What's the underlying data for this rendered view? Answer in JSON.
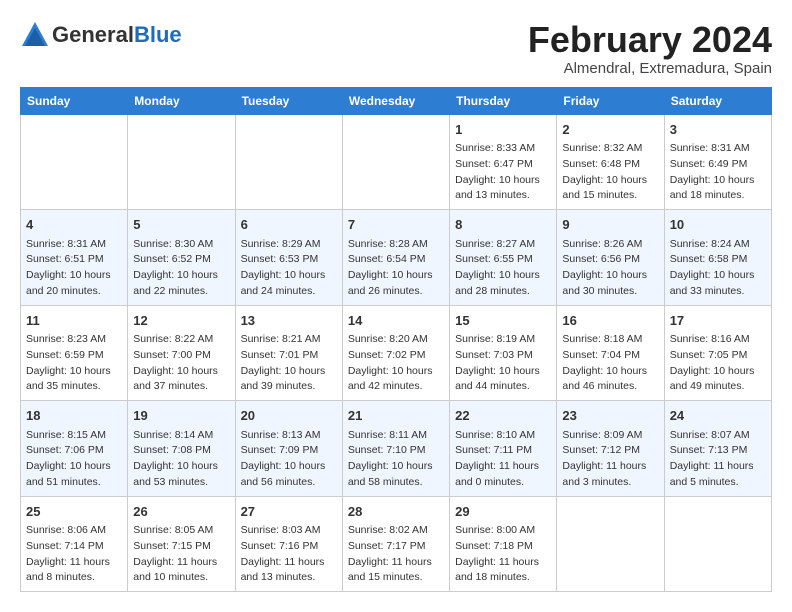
{
  "header": {
    "logo_general": "General",
    "logo_blue": "Blue",
    "month_year": "February 2024",
    "location": "Almendral, Extremadura, Spain"
  },
  "weekdays": [
    "Sunday",
    "Monday",
    "Tuesday",
    "Wednesday",
    "Thursday",
    "Friday",
    "Saturday"
  ],
  "weeks": [
    [
      {
        "day": "",
        "info": ""
      },
      {
        "day": "",
        "info": ""
      },
      {
        "day": "",
        "info": ""
      },
      {
        "day": "",
        "info": ""
      },
      {
        "day": "1",
        "info": "Sunrise: 8:33 AM\nSunset: 6:47 PM\nDaylight: 10 hours\nand 13 minutes."
      },
      {
        "day": "2",
        "info": "Sunrise: 8:32 AM\nSunset: 6:48 PM\nDaylight: 10 hours\nand 15 minutes."
      },
      {
        "day": "3",
        "info": "Sunrise: 8:31 AM\nSunset: 6:49 PM\nDaylight: 10 hours\nand 18 minutes."
      }
    ],
    [
      {
        "day": "4",
        "info": "Sunrise: 8:31 AM\nSunset: 6:51 PM\nDaylight: 10 hours\nand 20 minutes."
      },
      {
        "day": "5",
        "info": "Sunrise: 8:30 AM\nSunset: 6:52 PM\nDaylight: 10 hours\nand 22 minutes."
      },
      {
        "day": "6",
        "info": "Sunrise: 8:29 AM\nSunset: 6:53 PM\nDaylight: 10 hours\nand 24 minutes."
      },
      {
        "day": "7",
        "info": "Sunrise: 8:28 AM\nSunset: 6:54 PM\nDaylight: 10 hours\nand 26 minutes."
      },
      {
        "day": "8",
        "info": "Sunrise: 8:27 AM\nSunset: 6:55 PM\nDaylight: 10 hours\nand 28 minutes."
      },
      {
        "day": "9",
        "info": "Sunrise: 8:26 AM\nSunset: 6:56 PM\nDaylight: 10 hours\nand 30 minutes."
      },
      {
        "day": "10",
        "info": "Sunrise: 8:24 AM\nSunset: 6:58 PM\nDaylight: 10 hours\nand 33 minutes."
      }
    ],
    [
      {
        "day": "11",
        "info": "Sunrise: 8:23 AM\nSunset: 6:59 PM\nDaylight: 10 hours\nand 35 minutes."
      },
      {
        "day": "12",
        "info": "Sunrise: 8:22 AM\nSunset: 7:00 PM\nDaylight: 10 hours\nand 37 minutes."
      },
      {
        "day": "13",
        "info": "Sunrise: 8:21 AM\nSunset: 7:01 PM\nDaylight: 10 hours\nand 39 minutes."
      },
      {
        "day": "14",
        "info": "Sunrise: 8:20 AM\nSunset: 7:02 PM\nDaylight: 10 hours\nand 42 minutes."
      },
      {
        "day": "15",
        "info": "Sunrise: 8:19 AM\nSunset: 7:03 PM\nDaylight: 10 hours\nand 44 minutes."
      },
      {
        "day": "16",
        "info": "Sunrise: 8:18 AM\nSunset: 7:04 PM\nDaylight: 10 hours\nand 46 minutes."
      },
      {
        "day": "17",
        "info": "Sunrise: 8:16 AM\nSunset: 7:05 PM\nDaylight: 10 hours\nand 49 minutes."
      }
    ],
    [
      {
        "day": "18",
        "info": "Sunrise: 8:15 AM\nSunset: 7:06 PM\nDaylight: 10 hours\nand 51 minutes."
      },
      {
        "day": "19",
        "info": "Sunrise: 8:14 AM\nSunset: 7:08 PM\nDaylight: 10 hours\nand 53 minutes."
      },
      {
        "day": "20",
        "info": "Sunrise: 8:13 AM\nSunset: 7:09 PM\nDaylight: 10 hours\nand 56 minutes."
      },
      {
        "day": "21",
        "info": "Sunrise: 8:11 AM\nSunset: 7:10 PM\nDaylight: 10 hours\nand 58 minutes."
      },
      {
        "day": "22",
        "info": "Sunrise: 8:10 AM\nSunset: 7:11 PM\nDaylight: 11 hours\nand 0 minutes."
      },
      {
        "day": "23",
        "info": "Sunrise: 8:09 AM\nSunset: 7:12 PM\nDaylight: 11 hours\nand 3 minutes."
      },
      {
        "day": "24",
        "info": "Sunrise: 8:07 AM\nSunset: 7:13 PM\nDaylight: 11 hours\nand 5 minutes."
      }
    ],
    [
      {
        "day": "25",
        "info": "Sunrise: 8:06 AM\nSunset: 7:14 PM\nDaylight: 11 hours\nand 8 minutes."
      },
      {
        "day": "26",
        "info": "Sunrise: 8:05 AM\nSunset: 7:15 PM\nDaylight: 11 hours\nand 10 minutes."
      },
      {
        "day": "27",
        "info": "Sunrise: 8:03 AM\nSunset: 7:16 PM\nDaylight: 11 hours\nand 13 minutes."
      },
      {
        "day": "28",
        "info": "Sunrise: 8:02 AM\nSunset: 7:17 PM\nDaylight: 11 hours\nand 15 minutes."
      },
      {
        "day": "29",
        "info": "Sunrise: 8:00 AM\nSunset: 7:18 PM\nDaylight: 11 hours\nand 18 minutes."
      },
      {
        "day": "",
        "info": ""
      },
      {
        "day": "",
        "info": ""
      }
    ]
  ]
}
